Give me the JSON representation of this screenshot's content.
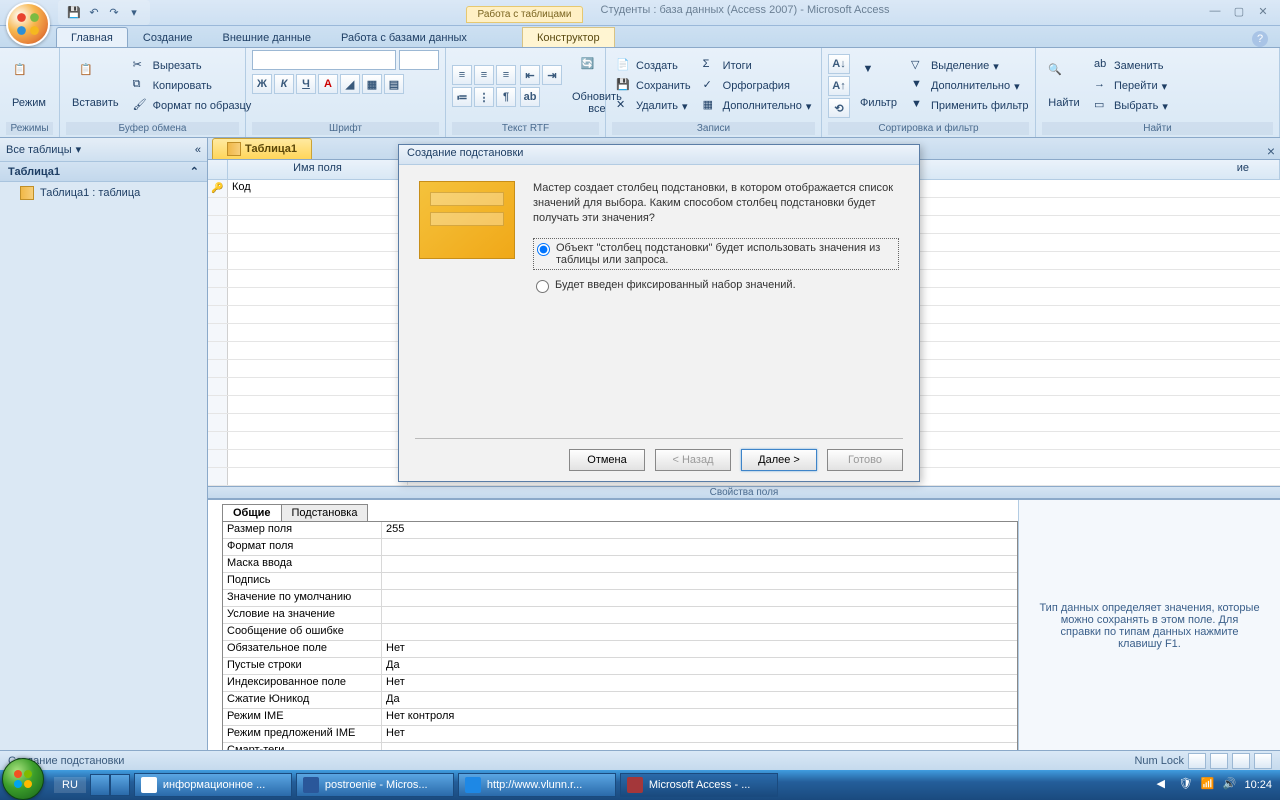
{
  "title": {
    "context_tab": "Работа с таблицами",
    "app_title": "Студенты : база данных (Access 2007) - Microsoft Access"
  },
  "ribbon_tabs": [
    "Главная",
    "Создание",
    "Внешние данные",
    "Работа с базами данных",
    "Конструктор"
  ],
  "ribbon": {
    "modes": {
      "label": "Режим",
      "group": "Режимы"
    },
    "clipboard": {
      "paste": "Вставить",
      "cut": "Вырезать",
      "copy": "Копировать",
      "format": "Формат по образцу",
      "group": "Буфер обмена"
    },
    "font": {
      "group": "Шрифт"
    },
    "richtext": {
      "group": "Текст RTF",
      "refresh": "Обновить\nвсе"
    },
    "records": {
      "new": "Создать",
      "save": "Сохранить",
      "delete": "Удалить",
      "totals": "Итоги",
      "spelling": "Орфография",
      "more": "Дополнительно",
      "group": "Записи"
    },
    "sortfilter": {
      "filter": "Фильтр",
      "selection": "Выделение",
      "advanced": "Дополнительно",
      "toggle": "Применить фильтр",
      "group": "Сортировка и фильтр"
    },
    "find": {
      "find": "Найти",
      "replace": "Заменить",
      "goto": "Перейти",
      "select": "Выбрать",
      "group": "Найти"
    }
  },
  "navpane": {
    "header": "Все таблицы",
    "group": "Таблица1",
    "item": "Таблица1 : таблица"
  },
  "doc_tab": "Таблица1",
  "design_grid": {
    "col_name": "Имя поля",
    "col_type": "ие",
    "row1_name": "Код"
  },
  "props_split_label": "Свойства поля",
  "prop_tabs": [
    "Общие",
    "Подстановка"
  ],
  "props": [
    {
      "n": "Размер поля",
      "v": "255"
    },
    {
      "n": "Формат поля",
      "v": ""
    },
    {
      "n": "Маска ввода",
      "v": ""
    },
    {
      "n": "Подпись",
      "v": ""
    },
    {
      "n": "Значение по умолчанию",
      "v": ""
    },
    {
      "n": "Условие на значение",
      "v": ""
    },
    {
      "n": "Сообщение об ошибке",
      "v": ""
    },
    {
      "n": "Обязательное поле",
      "v": "Нет"
    },
    {
      "n": "Пустые строки",
      "v": "Да"
    },
    {
      "n": "Индексированное поле",
      "v": "Нет"
    },
    {
      "n": "Сжатие Юникод",
      "v": "Да"
    },
    {
      "n": "Режим IME",
      "v": "Нет контроля"
    },
    {
      "n": "Режим предложений IME",
      "v": "Нет"
    },
    {
      "n": "Смарт-теги",
      "v": ""
    }
  ],
  "hint": "Тип данных определяет значения, которые можно сохранять в этом поле.  Для справки по типам данных нажмите клавишу F1.",
  "wizard": {
    "title": "Создание подстановки",
    "intro": "Мастер создает столбец подстановки, в котором отображается список значений для выбора.  Каким способом столбец подстановки будет получать эти значения?",
    "opt1": "Объект \"столбец подстановки\" будет использовать значения из таблицы или запроса.",
    "opt2": "Будет введен фиксированный набор значений.",
    "cancel": "Отмена",
    "back": "< Назад",
    "next": "Далее >",
    "finish": "Готово"
  },
  "statusbar": {
    "left": "Создание подстановки",
    "numlock": "Num Lock"
  },
  "taskbar": {
    "lang": "RU",
    "items": [
      "информационное ...",
      "postroenie - Micros...",
      "http://www.vlunn.r...",
      "Microsoft Access - ..."
    ],
    "time": "10:24"
  }
}
